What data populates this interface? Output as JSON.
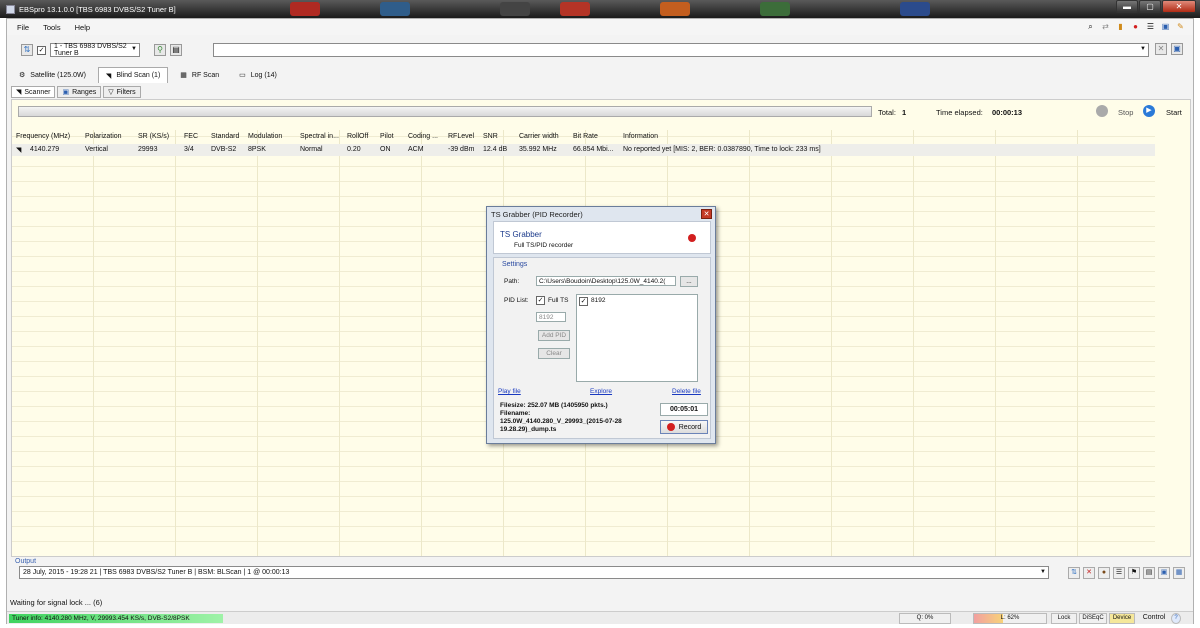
{
  "window": {
    "title": "EBSpro 13.1.0.0 [TBS 6983 DVBS/S2 Tuner B]",
    "minimize": "▬",
    "maximize": "▢",
    "close": "✕"
  },
  "menu": [
    "File",
    "Tools",
    "Help"
  ],
  "toolbar": {
    "tuner": "1 - TBS 6983 DVBS/S2 Tuner B"
  },
  "main_tabs": [
    "Satellite (125.0W)",
    "Blind Scan (1)",
    "RF Scan",
    "Log (14)"
  ],
  "sub_tabs": [
    "Scanner",
    "Ranges",
    "Filters"
  ],
  "scan": {
    "total_label": "Total:",
    "total": "1",
    "elapsed_label": "Time elapsed:",
    "elapsed": "00:00:13",
    "stop": "Stop",
    "start": "Start"
  },
  "table": {
    "headers": [
      "Frequency (MHz)",
      "Polarization",
      "SR (KS/s)",
      "FEC",
      "Standard",
      "Modulation",
      "Spectral in...",
      "RollOff",
      "Pilot",
      "Coding ...",
      "RFLevel",
      "SNR",
      "Carrier width",
      "Bit Rate",
      "Information"
    ],
    "rows": [
      [
        "4140.279",
        "Vertical",
        "29993",
        "3/4",
        "DVB-S2",
        "8PSK",
        "Normal",
        "0.20",
        "ON",
        "ACM",
        "-39 dBm",
        "12.4 dB",
        "35.992 MHz",
        "66.854 Mbi...",
        "No reported yet [MIS: 2, BER: 0.0387890, Time to lock: 233 ms]"
      ]
    ]
  },
  "output": {
    "label": "Output",
    "line": "28 July, 2015 - 19:28 21 | TBS 6983 DVBS/S2 Tuner B | BSM: BLScan | 1 @ 00:00:13"
  },
  "status": {
    "message": "Waiting for signal lock ... (6)",
    "tuner_info": "Tuner info: 4140.280 MHz, V, 29993.454 KS/s, DVB-S2/8PSK",
    "quality": "Q: 0%",
    "level": "L: 62%",
    "items": [
      "Lock",
      "DiSEqC",
      "Device"
    ],
    "control": "Control"
  },
  "dialog": {
    "title": "TS Grabber (PID Recorder)",
    "heading": "TS Grabber",
    "subheading": "Full TS/PID recorder",
    "settings": "Settings",
    "path_label": "Path:",
    "path": "C:\\Users\\Boudoin\\Desktop\\125.0W_4140.2(",
    "browse": "...",
    "pid_label": "PID List:",
    "full_ts": "Full TS",
    "pid_value": "8192",
    "add_pid": "Add PID",
    "clear": "Clear",
    "pid_items": [
      "8192"
    ],
    "play": "Play file",
    "explore": "Explore",
    "delete": "Delete file",
    "filesize": "Filesize: 252.07 MB (1405950 pkts.)",
    "filename_label": "Filename:",
    "filename": "125.0W_4140.280_V_29993_(2015-07-28 19.28.29)_dump.ts",
    "timer": "00:05:01",
    "record": "Record"
  }
}
